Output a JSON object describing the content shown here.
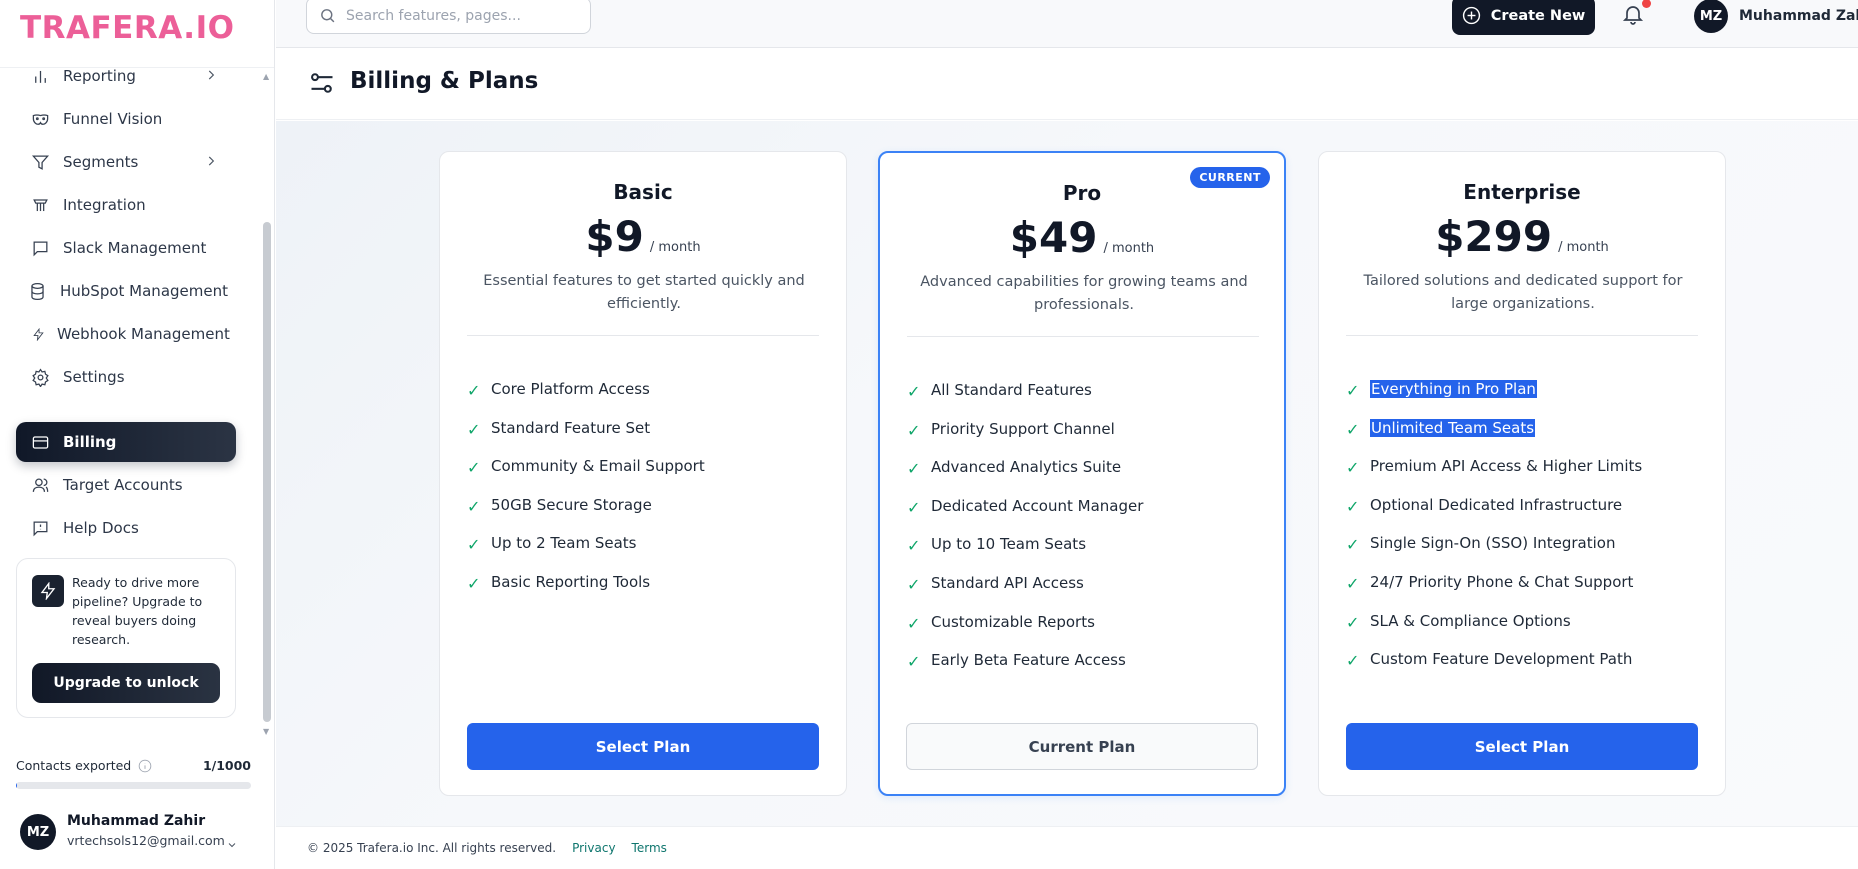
{
  "brand": {
    "logo": "TRAFERA.IO",
    "logo_color": "#ec5f98"
  },
  "sidebar": {
    "items": [
      {
        "label": "Reporting",
        "icon": "bar-chart-icon",
        "has_chevron": true
      },
      {
        "label": "Funnel Vision",
        "icon": "mask-icon"
      },
      {
        "label": "Segments",
        "icon": "filter-icon",
        "has_chevron": true
      },
      {
        "label": "Integration",
        "icon": "integration-icon"
      },
      {
        "label": "Slack Management",
        "icon": "message-square-icon"
      },
      {
        "label": "HubSpot Management",
        "icon": "database-icon"
      },
      {
        "label": "Webhook Management",
        "icon": "lightning-icon"
      },
      {
        "label": "Settings",
        "icon": "gear-icon"
      },
      {
        "label": "Billing",
        "icon": "credit-card-icon",
        "active": true
      },
      {
        "label": "Target Accounts",
        "icon": "users-icon"
      },
      {
        "label": "Help Docs",
        "icon": "help-message-icon"
      }
    ],
    "upgrade": {
      "text": "Ready to drive more pipeline? Upgrade to reveal buyers doing research.",
      "button": "Upgrade to unlock"
    },
    "contacts": {
      "label": "Contacts exported",
      "count": "1/1000",
      "progress": 0.001
    },
    "user": {
      "initials": "MZ",
      "name": "Muhammad Zahir",
      "email": "vrtechsols12@gmail.com"
    }
  },
  "topbar": {
    "search_placeholder": "Search features, pages...",
    "create_label": "Create New",
    "user_initials": "MZ",
    "user_name": "Muhammad Zahir"
  },
  "page": {
    "title": "Billing & Plans"
  },
  "plans": [
    {
      "name": "Basic",
      "price": "$9",
      "period": "/ month",
      "description": "Essential features to get started quickly and efficiently.",
      "features": [
        "Core Platform Access",
        "Standard Feature Set",
        "Community & Email Support",
        "50GB Secure Storage",
        "Up to 2 Team Seats",
        "Basic Reporting Tools"
      ],
      "button": "Select Plan"
    },
    {
      "name": "Pro",
      "price": "$49",
      "period": "/ month",
      "badge": "CURRENT",
      "description": "Advanced capabilities for growing teams and professionals.",
      "features": [
        "All Standard Features",
        "Priority Support Channel",
        "Advanced Analytics Suite",
        "Dedicated Account Manager",
        "Up to 10 Team Seats",
        "Standard API Access",
        "Customizable Reports",
        "Early Beta Feature Access"
      ],
      "button": "Current Plan"
    },
    {
      "name": "Enterprise",
      "price": "$299",
      "period": "/ month",
      "description": "Tailored solutions and dedicated support for large organizations.",
      "features": [
        "Everything in Pro Plan",
        "Unlimited Team Seats",
        "Premium API Access & Higher Limits",
        "Optional Dedicated Infrastructure",
        "Single Sign-On (SSO) Integration",
        "24/7 Priority Phone & Chat Support",
        "SLA & Compliance Options",
        "Custom Feature Development Path"
      ],
      "button": "Select Plan"
    }
  ],
  "footer": {
    "copyright": "© 2025 Trafera.io Inc. All rights reserved.",
    "privacy": "Privacy",
    "terms": "Terms"
  },
  "colors": {
    "primary": "#2563eb",
    "dark": "#111827",
    "check": "#10a66a"
  }
}
